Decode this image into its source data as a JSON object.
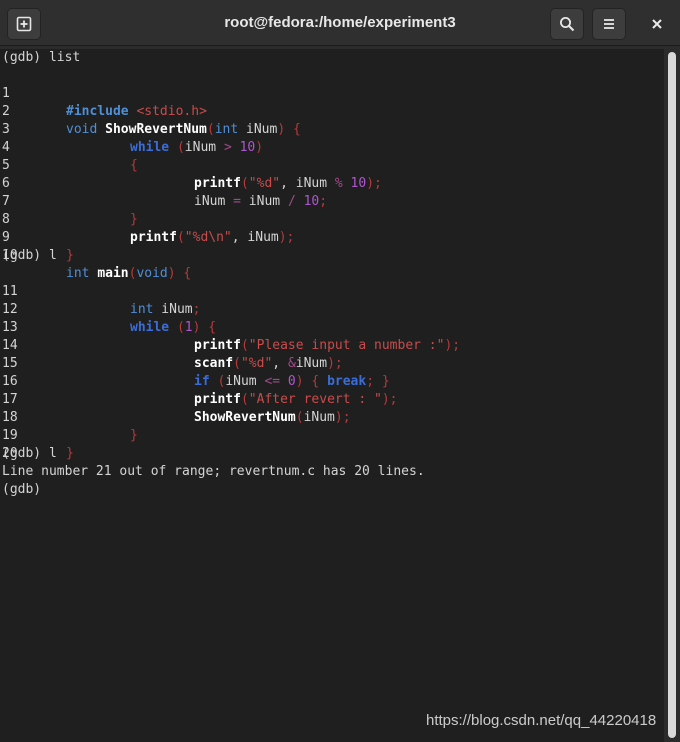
{
  "window": {
    "title": "root@fedora:/home/experiment3"
  },
  "toolbar": {
    "new_tab_icon": "new-tab-icon",
    "search_icon": "search-icon",
    "menu_icon": "hamburger-menu-icon",
    "close_icon": "close-icon"
  },
  "terminal": {
    "prompt1": "(gdb) list",
    "prompt2": "(gdb) l",
    "prompt3": "(gdb) l",
    "error": "Line number 21 out of range; revertnum.c has 20 lines.",
    "prompt4": "(gdb)",
    "lines": [
      {
        "n": "1",
        "t": [
          "#include",
          "<stdio.h>"
        ]
      },
      {
        "n": "2",
        "t": [
          "void",
          "ShowRevertNum",
          "(",
          "int",
          " iNum",
          ")",
          " {"
        ]
      },
      {
        "n": "3",
        "t": [
          "while",
          " (",
          "iNum ",
          ">",
          " 10",
          ")"
        ]
      },
      {
        "n": "4",
        "t": [
          "{"
        ]
      },
      {
        "n": "5",
        "t": [
          "printf",
          "(",
          "\"%d\"",
          ", iNum ",
          "%",
          " 10",
          ");"
        ]
      },
      {
        "n": "6",
        "t": [
          "iNum ",
          "=",
          " iNum ",
          "/",
          " 10",
          ";"
        ]
      },
      {
        "n": "7",
        "t": [
          "}"
        ]
      },
      {
        "n": "8",
        "t": [
          "printf",
          "(",
          "\"%d\\n\"",
          ", iNum",
          ");"
        ]
      },
      {
        "n": "9",
        "t": [
          "}"
        ]
      },
      {
        "n": "10",
        "t": [
          "int",
          "main",
          "(",
          "void",
          ")",
          " {"
        ]
      },
      {
        "n": "11",
        "t": [
          "int",
          " iNum",
          ";"
        ]
      },
      {
        "n": "12",
        "t": [
          "while",
          " (",
          "1",
          ")",
          " {"
        ]
      },
      {
        "n": "13",
        "t": [
          "printf",
          "(",
          "\"Please input a number :\"",
          ");"
        ]
      },
      {
        "n": "14",
        "t": [
          "scanf",
          "(",
          "\"%d\"",
          ", ",
          "&",
          "iNum",
          ");"
        ]
      },
      {
        "n": "15",
        "t": [
          "if",
          " (",
          "iNum ",
          "<=",
          " 0",
          ")",
          " { ",
          "break",
          ";",
          " }"
        ]
      },
      {
        "n": "16",
        "t": [
          "printf",
          "(",
          "\"After revert : \"",
          ");"
        ]
      },
      {
        "n": "17",
        "t": [
          "ShowRevertNum",
          "(",
          "iNum",
          ");"
        ]
      },
      {
        "n": "18",
        "t": [
          "}"
        ]
      },
      {
        "n": "19",
        "t": [
          "}"
        ]
      },
      {
        "n": "20",
        "t": []
      }
    ]
  },
  "watermark": "https://blog.csdn.net/qq_44220418",
  "colors": {
    "background": "#1f1f1f",
    "titlebar": "#2f2f2f",
    "keyword": "#3b6dd8",
    "string": "#c94b4b",
    "number": "#b055d0"
  }
}
